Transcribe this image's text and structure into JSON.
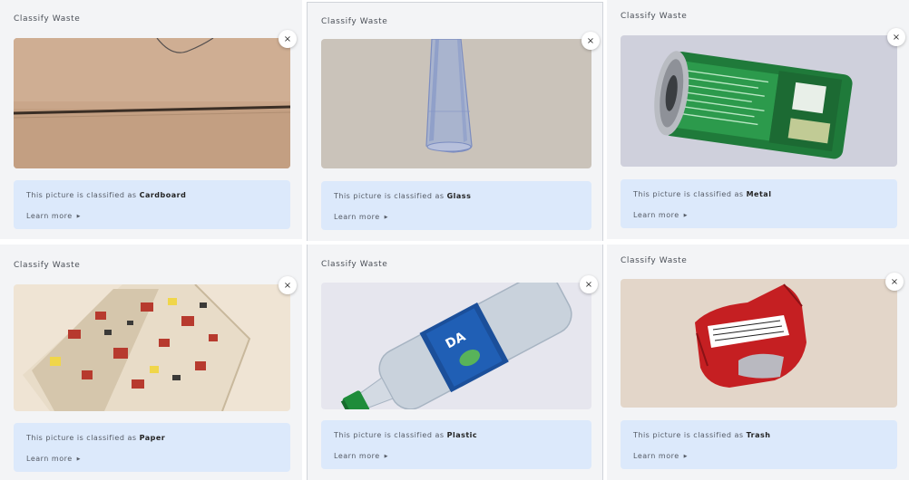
{
  "cards": [
    {
      "title": "Classify Waste",
      "prefix": "This picture is classified as ",
      "category": "Cardboard",
      "learn_more": "Learn more",
      "close": "×"
    },
    {
      "title": "Classify Waste",
      "prefix": "This picture is classified as ",
      "category": "Glass",
      "learn_more": "Learn more",
      "close": "×"
    },
    {
      "title": "Classify Waste",
      "prefix": "This picture is classified as ",
      "category": "Metal",
      "learn_more": "Learn more",
      "close": "×"
    },
    {
      "title": "Classify Waste",
      "prefix": "This picture is classified as ",
      "category": "Paper",
      "learn_more": "Learn more",
      "close": "×"
    },
    {
      "title": "Classify Waste",
      "prefix": "This picture is classified as ",
      "category": "Plastic",
      "learn_more": "Learn more",
      "close": "×"
    },
    {
      "title": "Classify Waste",
      "prefix": "This picture is classified as ",
      "category": "Trash",
      "learn_more": "Learn more",
      "close": "×"
    }
  ],
  "colors": {
    "panel_bg": "#f3f4f6",
    "result_bg": "#dce9fb"
  }
}
